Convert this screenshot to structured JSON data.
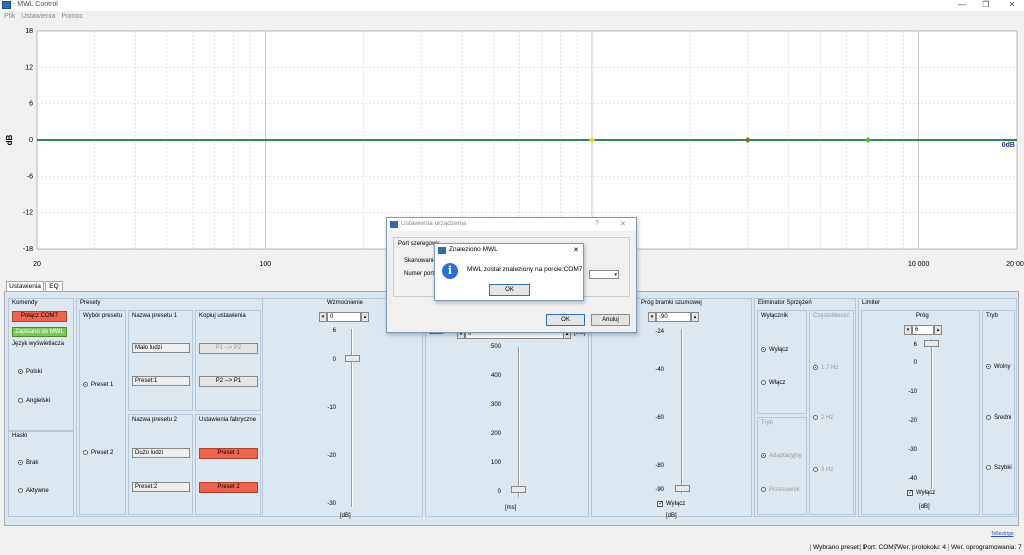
{
  "window": {
    "title": "- MWL Control",
    "minimize": "—",
    "maximize": "❐",
    "close": "✕"
  },
  "menu": [
    "Plik",
    "Ustawienia",
    "Pomoc"
  ],
  "chart": {
    "ylabel": "dB",
    "yticks": [
      "18",
      "12",
      "6",
      "0",
      "-6",
      "-12",
      "-18"
    ],
    "xticks": [
      "20",
      "100",
      "1000",
      "10 000",
      "20 000"
    ],
    "line_label": "0dB",
    "color": "#2e8b57"
  },
  "chart_data": {
    "type": "line",
    "xscale": "log",
    "xlim": [
      20,
      20000
    ],
    "ylim": [
      -18,
      18
    ],
    "series": [
      {
        "name": "",
        "x": [
          20,
          20000
        ],
        "y": [
          0,
          0
        ]
      }
    ],
    "markers": [
      {
        "x": 1000,
        "y": 0,
        "color": "#e8d81a"
      },
      {
        "x": 3000,
        "y": 0,
        "color": "#8a6a1a"
      },
      {
        "x": 7000,
        "y": 0,
        "color": "#45c22f"
      }
    ],
    "title": "",
    "xlabel": "",
    "ylabel": "dB"
  },
  "tabs": [
    "Ustawienia",
    "EQ"
  ],
  "commands": {
    "title": "Komendy",
    "connect": "Połącz COM7",
    "save": "Zapisano do MWL",
    "lang_label": "Język wyświetlacza",
    "lang_opt1": "Polski",
    "lang_opt2": "Angielski",
    "pass_title": "Hasło",
    "pass_opt1": "Brak",
    "pass_opt2": "Aktywne"
  },
  "presets": {
    "title": "Presety",
    "select_title": "Wybór presetu",
    "preset1": "Preset 1",
    "preset2": "Preset 2",
    "name1_title": "Nazwa presetu 1",
    "name1": "Mało ludzi",
    "name1_slot": "Preset:1",
    "name2_title": "Nazwa presetu 2",
    "name2": "Dużo ludzi",
    "name2_slot": "Preset:2",
    "copy_title": "Kopiuj ustawienia",
    "copy_p1p2": "P1 --> P2",
    "copy_p2p1": "P2 --> P1",
    "factory_title": "Ustawienia fabryczne",
    "factory_p1": "Preset 1",
    "factory_p2": "Preset 2"
  },
  "gain": {
    "title": "Wzmocnienie",
    "value": "0",
    "ticks": [
      "6",
      "0",
      "-10",
      "-20",
      "-30"
    ],
    "unit": "[dB]"
  },
  "delay": {
    "label": "Czas:",
    "value": "0",
    "unit": "[ms]",
    "ticks": [
      "500",
      "400",
      "300",
      "200",
      "100",
      "0"
    ],
    "unit2": "[ms]"
  },
  "gate": {
    "title": "Próg bramki szumowej",
    "value": "-90",
    "ticks": [
      "-24",
      "-40",
      "-60",
      "-80",
      "-90"
    ],
    "off": "Wyłącz",
    "unit": "[dB]"
  },
  "feedback": {
    "title": "Eliminator Sprzężeń",
    "sw_title": "Wyłącznik",
    "off": "Wyłącz",
    "on": "Włącz",
    "freq_title": "Częstotliwość",
    "f1": "1,7 Hz",
    "f2": "2 Hz",
    "f3": "3 Hz",
    "mode_title": "Tryb",
    "m1": "Adaptacyjny",
    "m2": "Przesuwnik"
  },
  "limiter": {
    "title": "Limiter",
    "thr_title": "Próg",
    "value": "6",
    "ticks": [
      "6",
      "0",
      "-10",
      "-20",
      "-30",
      "-40"
    ],
    "off": "Wyłącz",
    "unit": "[dB]",
    "mode_title": "Tryb",
    "m1": "Wolny",
    "m2": "Średni",
    "m3": "Szybki"
  },
  "link": "Tellestrigo",
  "status": [
    "Wybrano preset: 1",
    "Port: COM7",
    "Wer. protokołu: 4",
    "Wer. oprogramowania: 7"
  ],
  "dialog1": {
    "title": "Ustawienia urządzenia",
    "help": "?",
    "close": "✕",
    "group": "Port szeregowy",
    "scan": "Skanowanie",
    "port_label": "Numer portu:",
    "ok": "OK",
    "cancel": "Anuluj"
  },
  "dialog2": {
    "title": "Znaleziono MWL",
    "close": "✕",
    "message": "MWL został znaleziony na porcie:COM7",
    "ok": "OK"
  }
}
